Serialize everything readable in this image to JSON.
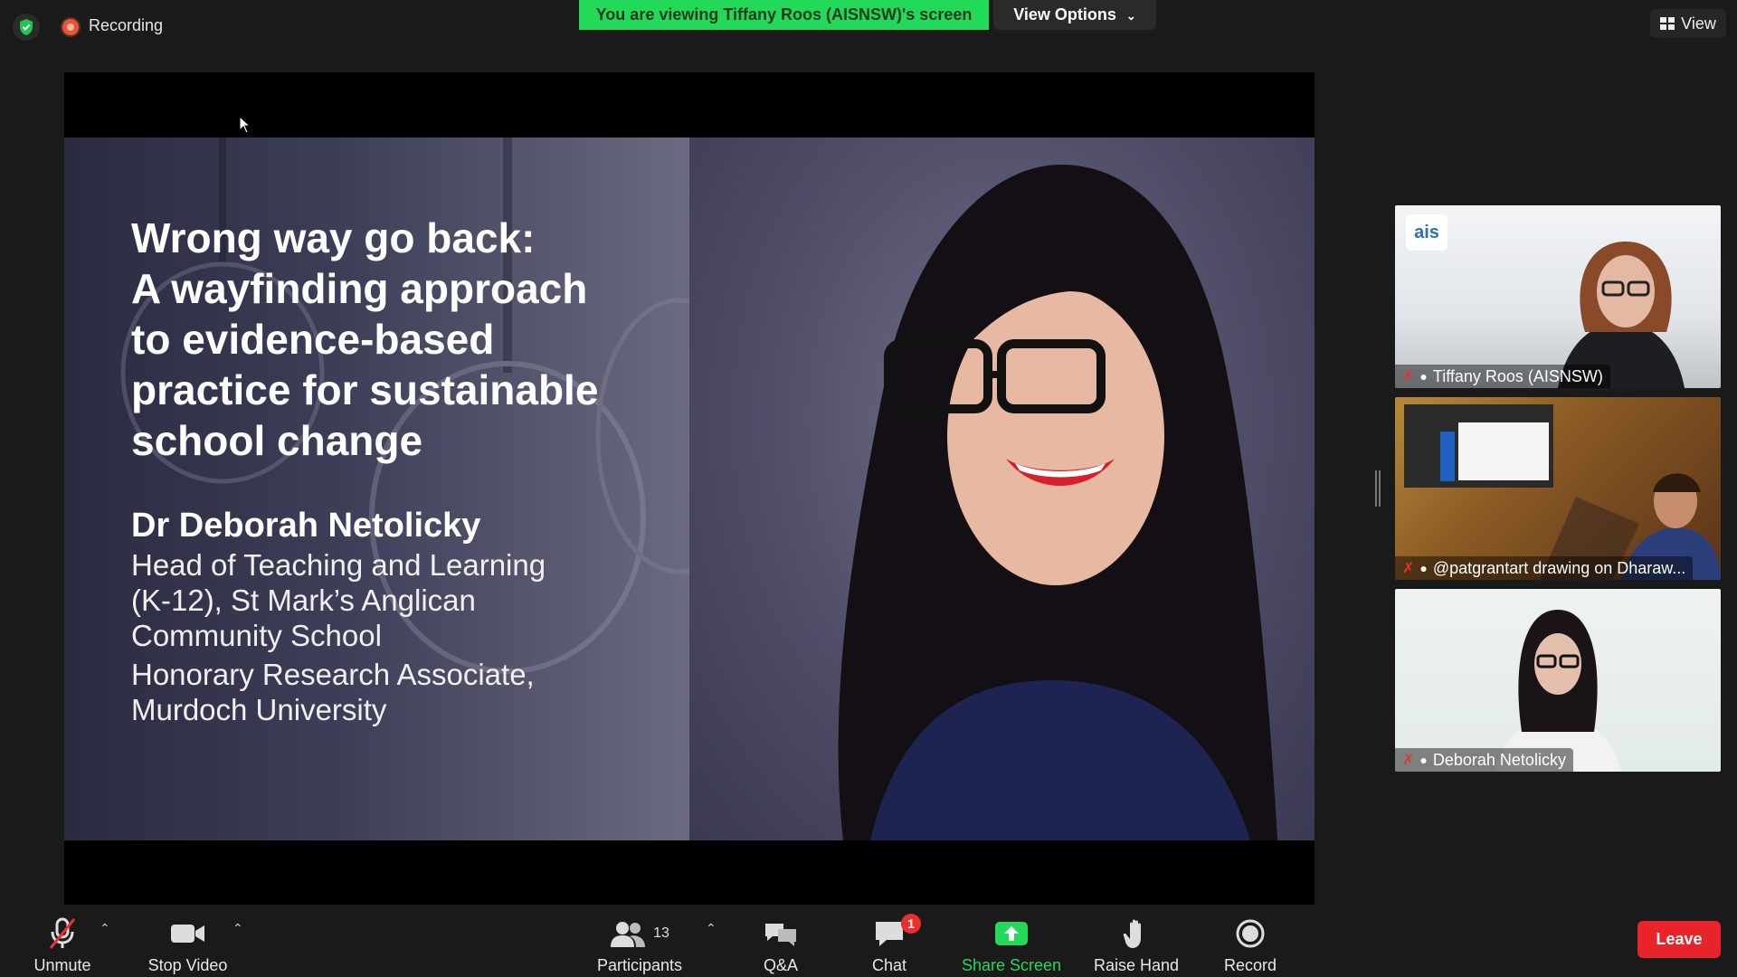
{
  "top_bar": {
    "recording_label": "Recording",
    "viewing_banner": "You are viewing Tiffany Roos (AISNSW)'s screen",
    "view_options_label": "View Options",
    "view_label": "View",
    "icons": [
      "shield-check-icon",
      "recording-icon",
      "chevron-down-icon",
      "grid-icon"
    ]
  },
  "shared_screen": {
    "slide_title": "Wrong way go back:\nA wayfinding approach\nto evidence-based\npractice for sustainable\nschool change",
    "presenter_name": "Dr Deborah Netolicky",
    "presenter_role": "Head of Teaching and Learning\n(K-12), St Mark’s Anglican\nCommunity School",
    "presenter_affiliation": "Honorary Research Associate,\nMurdoch University"
  },
  "gallery": [
    {
      "name": "Tiffany Roos (AISNSW)",
      "logo_text": "ais",
      "muted": true
    },
    {
      "name": "@patgrantart drawing on Dharaw...",
      "muted": true
    },
    {
      "name": "Deborah Netolicky",
      "muted": true
    }
  ],
  "toolbar": {
    "unmute_label": "Unmute",
    "stop_video_label": "Stop Video",
    "participants_label": "Participants",
    "participants_count": "13",
    "qa_label": "Q&A",
    "chat_label": "Chat",
    "chat_badge": "1",
    "share_screen_label": "Share Screen",
    "raise_hand_label": "Raise Hand",
    "record_label": "Record",
    "leave_label": "Leave"
  },
  "colors": {
    "banner_green": "#23d959",
    "leave_red": "#e8232a",
    "badge_red": "#e8312f",
    "background": "#1a1a1a"
  }
}
